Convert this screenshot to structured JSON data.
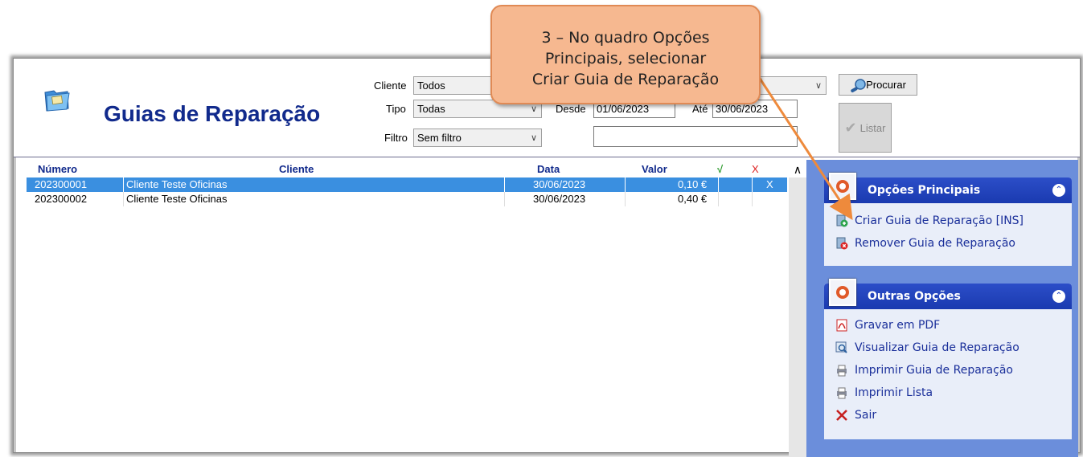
{
  "window": {
    "title": "Guias de Reparação"
  },
  "filters": {
    "cliente_label": "Cliente",
    "cliente_value": "Todos",
    "tipo_label": "Tipo",
    "tipo_value": "Todas",
    "filtro_label": "Filtro",
    "filtro_value": "Sem filtro",
    "desde_label": "Desde",
    "desde_value": "01/06/2023",
    "ate_label": "Até",
    "ate_value": "30/06/2023",
    "search_value": "",
    "procurar_label": "Procurar",
    "listar_label": "Listar"
  },
  "table": {
    "columns": [
      "Número",
      "Cliente",
      "Data",
      "Valor",
      "√",
      "X"
    ],
    "rows": [
      {
        "numero": "202300001",
        "cliente": "Cliente Teste Oficinas",
        "data": "30/06/2023",
        "valor": "0,10 €",
        "ok": "",
        "x": "X"
      },
      {
        "numero": "202300002",
        "cliente": "Cliente Teste Oficinas",
        "data": "30/06/2023",
        "valor": "0,40 €",
        "ok": "",
        "x": ""
      }
    ]
  },
  "sidebar": {
    "main_title": "Opções Principais",
    "main_items": [
      {
        "label": "Criar Guia de Reparação [INS]",
        "icon": "add-doc-icon"
      },
      {
        "label": "Remover Guia de Reparação",
        "icon": "remove-doc-icon"
      }
    ],
    "other_title": "Outras Opções",
    "other_items": [
      {
        "label": "Gravar em PDF",
        "icon": "pdf-icon"
      },
      {
        "label": "Visualizar Guia de Reparação",
        "icon": "preview-icon"
      },
      {
        "label": "Imprimir Guia de Reparação",
        "icon": "print-icon"
      },
      {
        "label": "Imprimir Lista",
        "icon": "print-icon"
      },
      {
        "label": "Sair",
        "icon": "close-icon"
      }
    ]
  },
  "callout": {
    "line1": "3 – No quadro Opções",
    "line2": "Principais, selecionar",
    "line3": "Criar Guia de Reparação"
  },
  "colors": {
    "title": "#112a8c",
    "selection": "#3a8fe0",
    "sidebar_bg": "#6b8edb",
    "panel_header": "#2c4ec8",
    "callout_fill": "#f6b890",
    "arrow": "#ee8a3c"
  }
}
